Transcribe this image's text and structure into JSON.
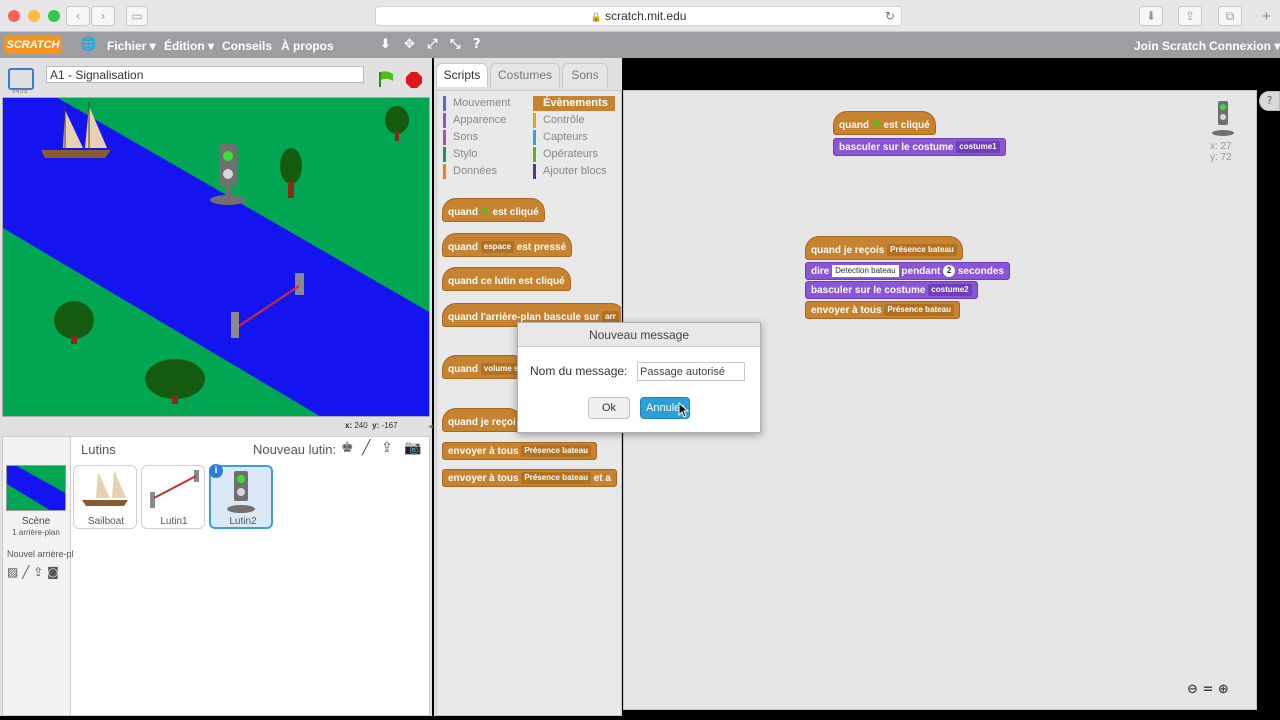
{
  "browser": {
    "url": "scratch.mit.edu"
  },
  "menu": {
    "items": [
      "Fichier ▾",
      "Édition ▾",
      "Conseils",
      "À propos"
    ],
    "join": "Join Scratch",
    "connexion": "Connexion ▾"
  },
  "project": {
    "title": "A1 - Signalisation",
    "version": "v453"
  },
  "stage": {
    "coords_x_label": "x:",
    "coords_x": "240",
    "coords_y_label": "y:",
    "coords_y": "-167"
  },
  "sprites": {
    "header": "Lutins",
    "new_sprite_label": "Nouveau lutin:",
    "scene_label": "Scène",
    "scene_sub": "1 arrière-plan",
    "new_backdrop_label": "Nouvel arrière-pl",
    "items": [
      {
        "name": "Sailboat"
      },
      {
        "name": "Lutin1"
      },
      {
        "name": "Lutin2"
      }
    ]
  },
  "tabs": [
    "Scripts",
    "Costumes",
    "Sons"
  ],
  "categories": {
    "left": [
      {
        "label": "Mouvement",
        "color": "#4a6cd4"
      },
      {
        "label": "Apparence",
        "color": "#8a55d7"
      },
      {
        "label": "Sons",
        "color": "#bb42c3"
      },
      {
        "label": "Stylo",
        "color": "#0e9a6c"
      },
      {
        "label": "Données",
        "color": "#ee7d16"
      }
    ],
    "right": [
      {
        "label": "Évènements",
        "color": "#c88330"
      },
      {
        "label": "Contrôle",
        "color": "#e1a91a"
      },
      {
        "label": "Capteurs",
        "color": "#2ca5e2"
      },
      {
        "label": "Opérateurs",
        "color": "#5cb712"
      },
      {
        "label": "Ajouter blocs",
        "color": "#632d99"
      }
    ]
  },
  "palette_blocks": {
    "b1_a": "quand",
    "b1_b": "est cliqué",
    "b2_a": "quand",
    "b2_drop": "espace",
    "b2_b": "est pressé",
    "b3": "quand ce lutin est cliqué",
    "b4": "quand l'arrière-plan bascule sur",
    "b4_drop": "arr",
    "b5_a": "quand",
    "b5_drop": "volume s",
    "b6": "quand je reçoi",
    "b7_a": "envoyer à tous",
    "b7_drop": "Présence bateau",
    "b8_a": "envoyer à tous",
    "b8_drop": "Présence bateau",
    "b8_b": "et a"
  },
  "script_blocks": {
    "s1_a": "quand",
    "s1_b": "est cliqué",
    "s2_a": "basculer sur le costume",
    "s2_drop": "costume1",
    "s3_a": "quand je reçois",
    "s3_drop": "Présence bateau",
    "s4_a": "dire",
    "s4_input": "Detection bateau",
    "s4_b": "pendant",
    "s4_num": "2",
    "s4_c": "secondes",
    "s5_a": "basculer sur le costume",
    "s5_drop": "costume2",
    "s6_a": "envoyer à tous",
    "s6_drop": "Présence bateau"
  },
  "sprite_info": {
    "x": "x: 27",
    "y": "y: 72"
  },
  "dialog": {
    "title": "Nouveau message",
    "label": "Nom du message:",
    "value": "Passage autorisé",
    "ok": "Ok",
    "cancel": "Annuler"
  }
}
